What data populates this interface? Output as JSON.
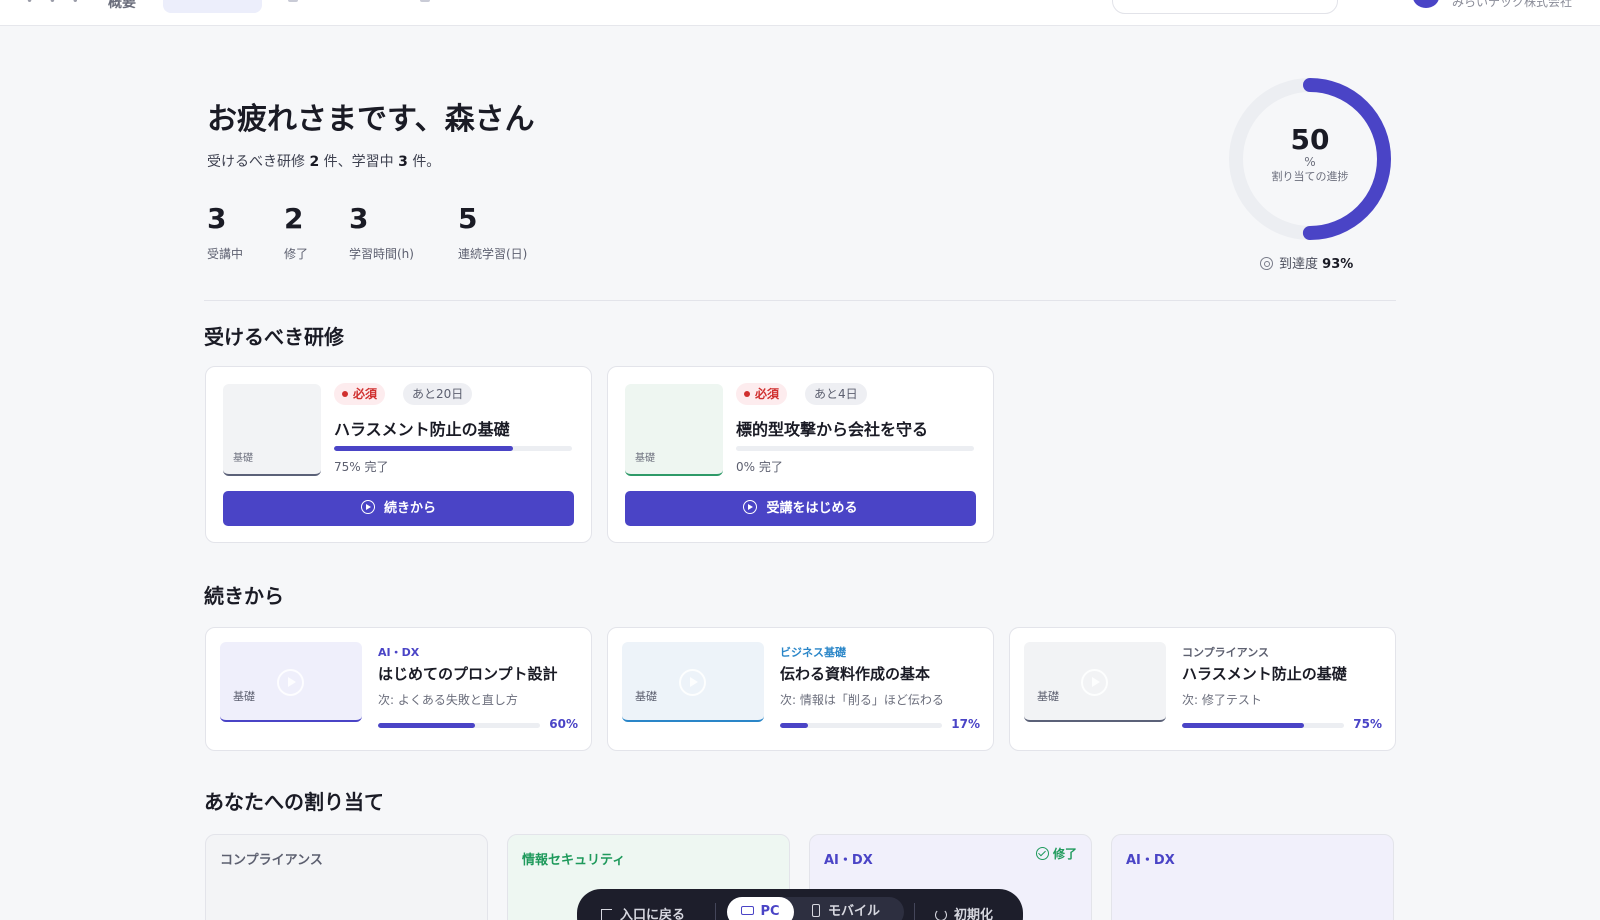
{
  "header": {
    "nav_label": "概要",
    "company": "みらいテック株式会社"
  },
  "hero": {
    "title": "お疲れさまです、森さん",
    "sub_prefix": "受けるべき研修",
    "sub_required": "2",
    "sub_mid": "件、学習中",
    "sub_inprogress": "3",
    "sub_suffix": "件。",
    "stats": [
      {
        "value": "3",
        "label": "受講中"
      },
      {
        "value": "2",
        "label": "修了"
      },
      {
        "value": "3",
        "label": "学習時間(h)"
      },
      {
        "value": "5",
        "label": "連続学習(日)"
      }
    ],
    "progress": {
      "value": "50",
      "fraction": 0.5,
      "unit": "%",
      "caption": "割り当ての進捗",
      "color": "#4a44c6"
    },
    "reach": {
      "label": "到達度",
      "value": "93%"
    }
  },
  "required": {
    "title": "受けるべき研修",
    "items": [
      {
        "badge": "必須",
        "due": "あと20日",
        "title": "ハラスメント防止の基礎",
        "progress": 0.75,
        "progress_text": "75% 完了",
        "thumb_label": "基礎",
        "thumb_bg": "#f2f3f5",
        "thumb_line": "#5b6178",
        "button": "続きから"
      },
      {
        "badge": "必須",
        "due": "あと4日",
        "title": "標的型攻撃から会社を守る",
        "progress": 0.0,
        "progress_text": "0% 完了",
        "thumb_label": "基礎",
        "thumb_bg": "#eef6f1",
        "thumb_line": "#2e9a68",
        "button": "受講をはじめる"
      }
    ]
  },
  "continue": {
    "title": "続きから",
    "items": [
      {
        "category": "AI・DX",
        "category_color": "#4a44c6",
        "title": "はじめてのプロンプト設計",
        "next": "次: よくある失敗と直し方",
        "progress": 0.6,
        "percent": "60%",
        "thumb_label": "基礎",
        "thumb_bg": "#efeffb",
        "thumb_line": "#4a44c6"
      },
      {
        "category": "ビジネス基礎",
        "category_color": "#2a86c8",
        "title": "伝わる資料作成の基本",
        "next": "次: 情報は「削る」ほど伝わる",
        "progress": 0.17,
        "percent": "17%",
        "thumb_label": "基礎",
        "thumb_bg": "#edf3f9",
        "thumb_line": "#2a86c8"
      },
      {
        "category": "コンプライアンス",
        "category_color": "#5d6070",
        "title": "ハラスメント防止の基礎",
        "next": "次: 修了テスト",
        "progress": 0.75,
        "percent": "75%",
        "thumb_label": "基礎",
        "thumb_bg": "#f2f3f5",
        "thumb_line": "#5b6178"
      }
    ]
  },
  "assigned": {
    "title": "あなたへの割り当て",
    "items": [
      {
        "category": "コンプライアンス",
        "color": "#5d6070",
        "bg": "#f3f4f6",
        "done": ""
      },
      {
        "category": "情報セキュリティ",
        "color": "#1f9a5c",
        "bg": "#eef7f2",
        "done": ""
      },
      {
        "category": "AI・DX",
        "color": "#4a44c6",
        "bg": "#f1f0fb",
        "done": "修了"
      },
      {
        "category": "AI・DX",
        "color": "#4a44c6",
        "bg": "#f1f0fb",
        "done": ""
      }
    ]
  },
  "dock": {
    "exit": "入口に戻る",
    "pc": "PC",
    "mobile": "モバイル",
    "reset": "初期化"
  }
}
